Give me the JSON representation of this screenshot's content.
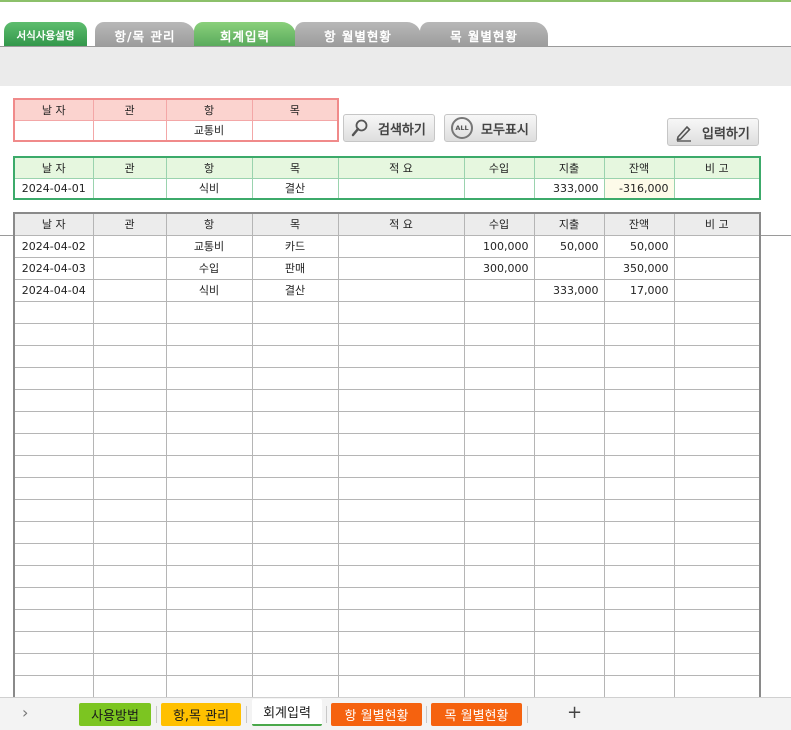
{
  "top_tabs": [
    {
      "label": "서식사용설명"
    },
    {
      "label": "항/목 관리"
    },
    {
      "label": "회계입력"
    },
    {
      "label": "항 월별현황"
    },
    {
      "label": "목 월별현황"
    }
  ],
  "columns": {
    "date": "날 자",
    "gwan": "관",
    "hang": "항",
    "mok": "목",
    "desc": "적 요",
    "income": "수입",
    "expense": "지출",
    "balance": "잔액",
    "note": "비 고"
  },
  "search": {
    "date": "",
    "gwan": "",
    "hang": "교통비",
    "mok": ""
  },
  "buttons": {
    "search": "검색하기",
    "show_all": "모두표시",
    "all_badge": "ALL",
    "input": "입력하기"
  },
  "last_entry": {
    "date": "2024-04-01",
    "gwan": "",
    "hang": "식비",
    "mok": "결산",
    "desc": "",
    "income": "",
    "expense": "333,000",
    "balance": "-316,000",
    "note": ""
  },
  "rows": [
    {
      "date": "2024-04-02",
      "gwan": "",
      "hang": "교통비",
      "mok": "카드",
      "desc": "",
      "income": "100,000",
      "expense": "50,000",
      "balance": "50,000",
      "note": ""
    },
    {
      "date": "2024-04-03",
      "gwan": "",
      "hang": "수입",
      "mok": "판매",
      "desc": "",
      "income": "300,000",
      "expense": "",
      "balance": "350,000",
      "note": ""
    },
    {
      "date": "2024-04-04",
      "gwan": "",
      "hang": "식비",
      "mok": "결산",
      "desc": "",
      "income": "",
      "expense": "333,000",
      "balance": "17,000",
      "note": ""
    }
  ],
  "sheet_tabs": [
    {
      "label": "사용방법",
      "bg": "#7cc521",
      "fg": "#1a1a1a"
    },
    {
      "label": "항,목 관리",
      "bg": "#ffc000",
      "fg": "#1a1a1a"
    },
    {
      "label": "회계입력",
      "bg": "#ffffff",
      "fg": "#1a1a1a"
    },
    {
      "label": "항 월별현황",
      "bg": "#f5620f",
      "fg": "#ffffff"
    },
    {
      "label": "목 월별현황",
      "bg": "#f5620f",
      "fg": "#ffffff"
    }
  ],
  "sheetbar": {
    "nav_glyph": "›",
    "add_glyph": "+"
  },
  "colors": {
    "accent_green": "#3caa6a",
    "search_red": "#f08a8a",
    "balance_fill": "#fdfbe9"
  }
}
